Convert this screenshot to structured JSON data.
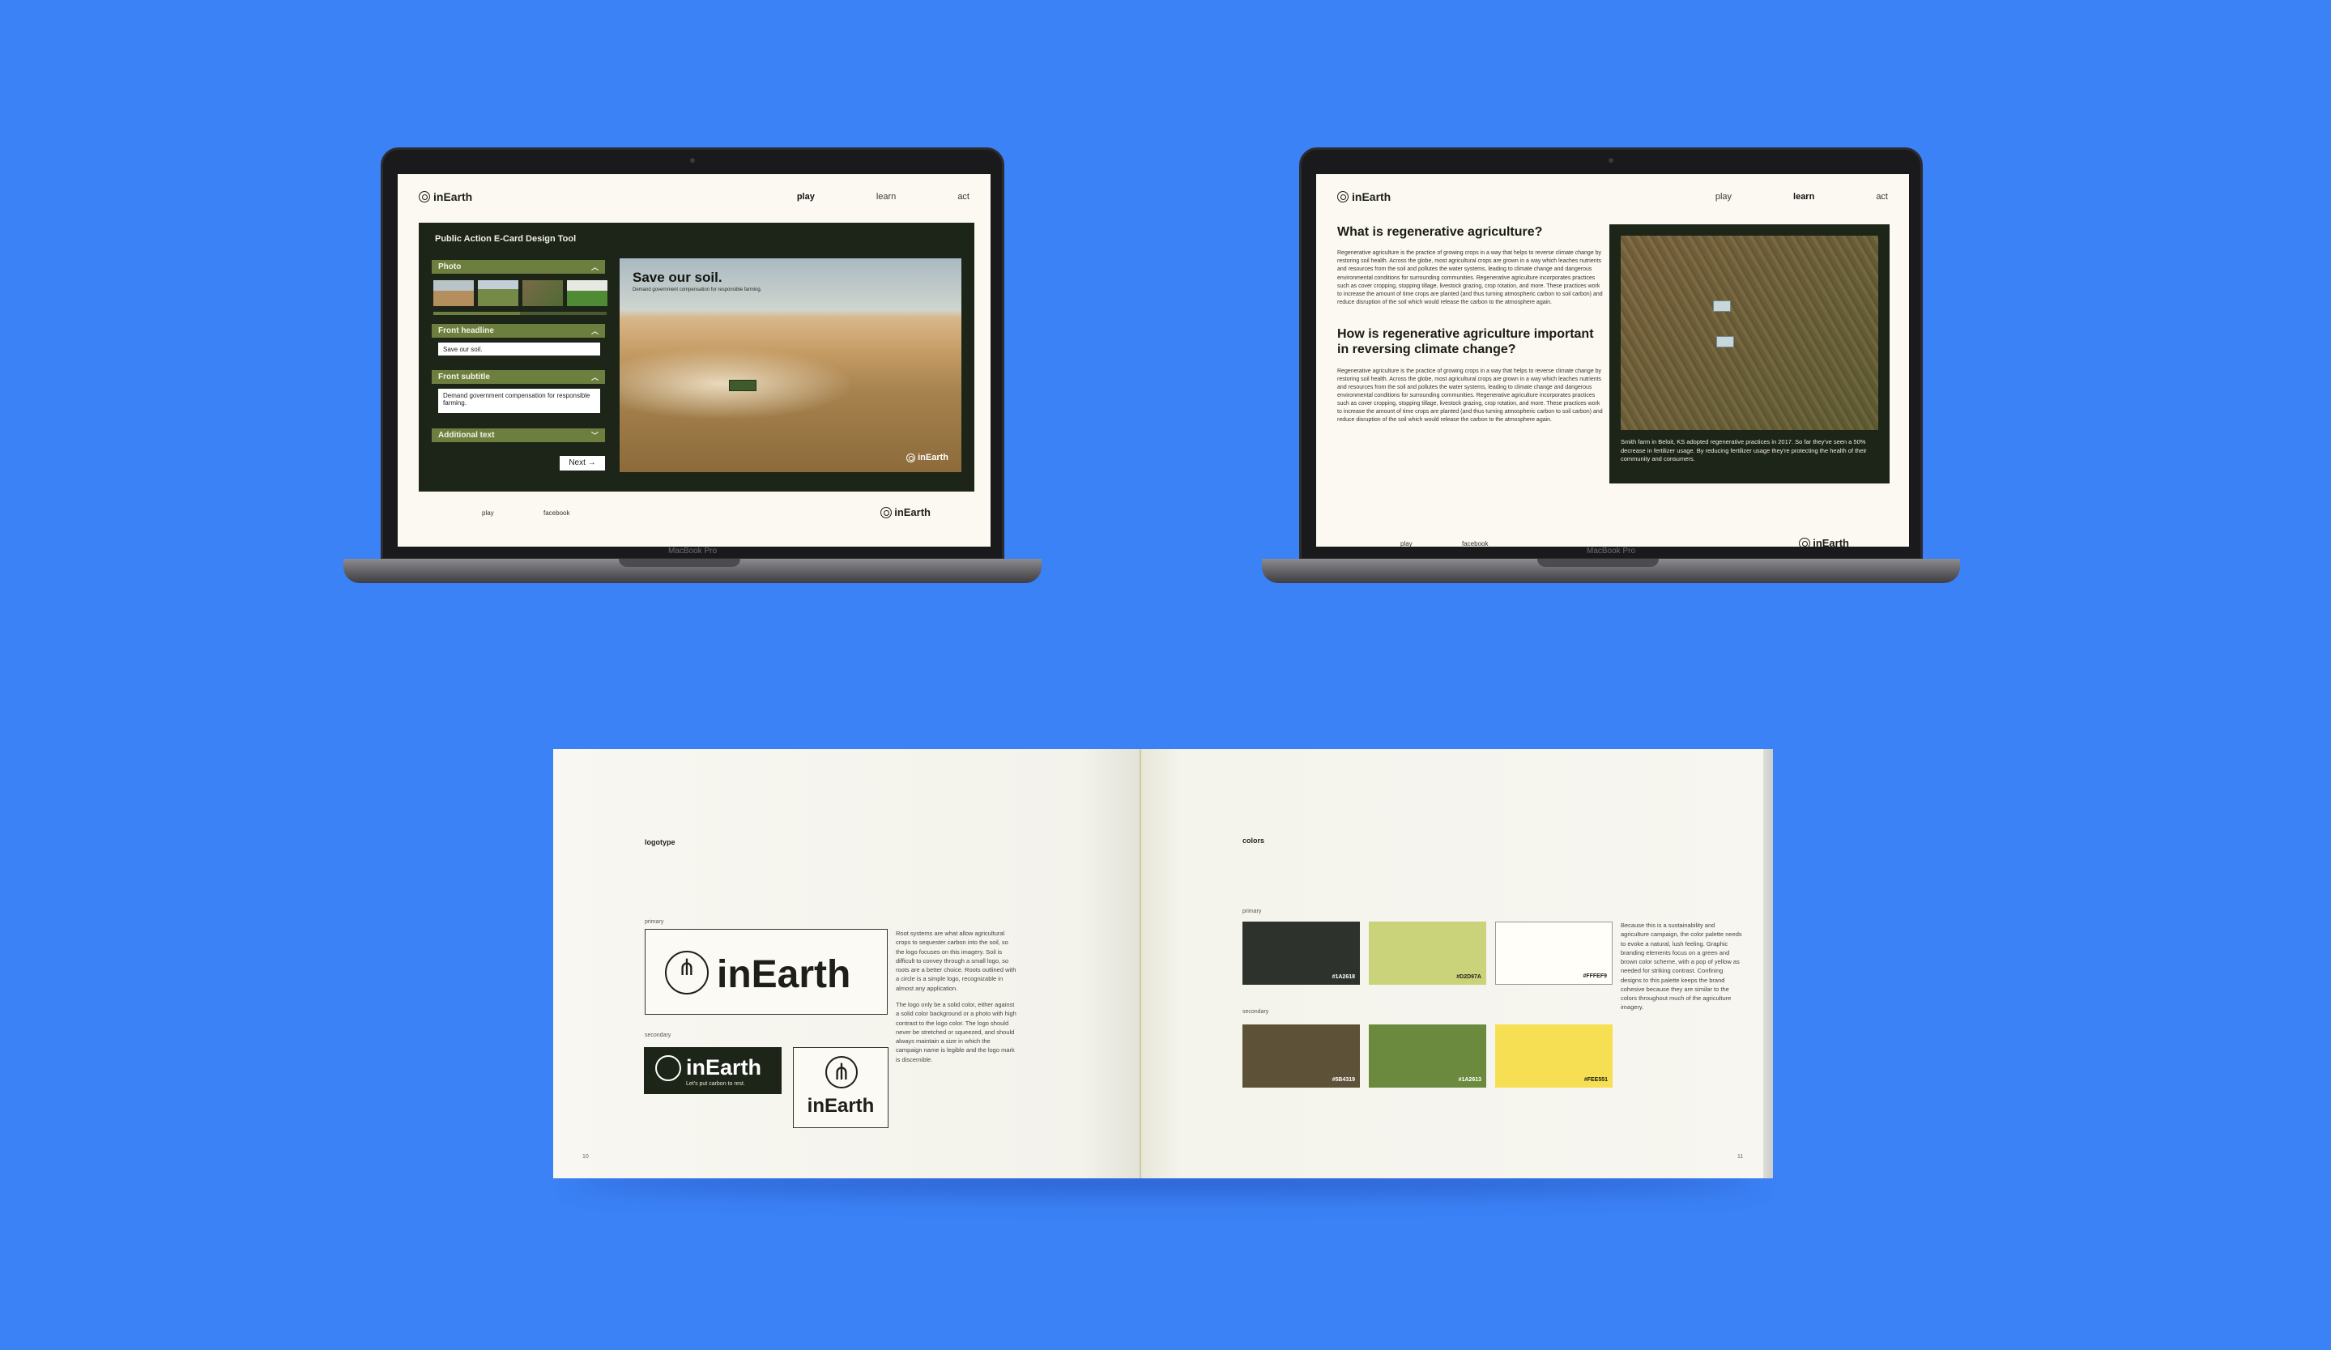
{
  "brand": {
    "name": "inEarth",
    "device_label": "MacBook Pro"
  },
  "left_laptop": {
    "nav": {
      "logo": "inEarth",
      "play": "play",
      "learn": "learn",
      "act": "act",
      "active": "play"
    },
    "tool_title": "Public Action E-Card Design Tool",
    "photo_section": "Photo",
    "headline_section": "Front headline",
    "headline_value": "Save our soil.",
    "subtitle_section": "Front subtitle",
    "subtitle_value": "Demand government compensation for responsible farming.",
    "additional_section": "Additional text",
    "next_button": "Next →",
    "preview": {
      "headline": "Save our soil.",
      "subtitle": "Demand government compensation for responsible farming.",
      "watermark": "inEarth"
    },
    "slider_fraction": 0.5,
    "footer": {
      "link1": "play",
      "link2": "facebook",
      "logo": "inEarth"
    }
  },
  "right_laptop": {
    "nav": {
      "logo": "inEarth",
      "play": "play",
      "learn": "learn",
      "act": "act",
      "active": "learn"
    },
    "q1": "What is regenerative agriculture?",
    "p1": "Regenerative agriculture is the practice of growing crops in a way that helps to reverse climate change by restoring soil health. Across the globe, most agricultural crops are grown in a way which leaches nutrients and resources from the soil and pollutes the water systems, leading to climate change and dangerous environmental conditions for surrounding communities. Regenerative agriculture incorporates practices such as cover cropping, stopping tillage, livestock grazing, crop rotation, and more. These practices work to increase the amount of time crops are planted (and thus turning atmospheric carbon to soil carbon) and reduce disruption of the soil which would release the carbon to the atmosphere again.",
    "q2": "How is regenerative agriculture important in reversing climate change?",
    "p2": "Regenerative agriculture is the practice of growing crops in a way that helps to reverse climate change by restoring soil health. Across the globe, most agricultural crops are grown in a way which leaches nutrients and resources from the soil and pollutes the water systems, leading to climate change and dangerous environmental conditions for surrounding communities. Regenerative agriculture incorporates practices such as cover cropping, stopping tillage, livestock grazing, crop rotation, and more. These practices work to increase the amount of time crops are planted (and thus turning atmospheric carbon to soil carbon) and reduce disruption of the soil which would release the carbon to the atmosphere again.",
    "caption": "Smith farm in Beloit, KS adopted regenerative practices in 2017. So far they've seen a 50% decrease in fertilizer usage. By reducing fertilizer usage they're protecting the health of their community and consumers.",
    "footer": {
      "link1": "play",
      "link2": "facebook",
      "logo": "inEarth"
    }
  },
  "book": {
    "left": {
      "section": "logotype",
      "primary_label": "primary",
      "secondary_label": "secondary",
      "wordmark": "inEarth",
      "tagline": "Let's put carbon to rest.",
      "copy1": "Root systems are what allow agricultural crops to sequester carbon into the soil, so the logo focuses on this imagery. Soil is difficult to convey through a small logo, so roots are a better choice. Roots outlined with a circle is a simple logo, recognizable in almost any application.",
      "copy2": "The logo only be a solid color, either against a solid color background or a photo with high contrast to the logo color. The logo should never be stretched or squeezed, and should always maintain a size in which the campaign name is legible and the logo mark is discernible.",
      "page_number": "10"
    },
    "right": {
      "section": "colors",
      "primary_label": "primary",
      "secondary_label": "secondary",
      "swatches_primary": [
        {
          "hex": "#1A2618",
          "color": "#2d332c",
          "text_color": "#ffffff"
        },
        {
          "hex": "#D2D97A",
          "color": "#cbd37a",
          "text_color": "#1d1f18"
        },
        {
          "hex": "#FFFEF9",
          "color": "#fffef9",
          "text_color": "#1d1f18"
        }
      ],
      "swatches_secondary": [
        {
          "hex": "#5B4319",
          "color": "#5d5138",
          "text_color": "#ffffff"
        },
        {
          "hex": "#1A2613",
          "color": "#6b8a3e",
          "text_color": "#ffffff"
        },
        {
          "hex": "#FEE551",
          "color": "#f6df52",
          "text_color": "#1d1f18"
        }
      ],
      "copy": "Because this is a sustainability and agriculture campaign, the color palette needs to evoke a natural, lush feeling. Graphic branding elements focus on a green and brown color scheme, with a pop of yellow as needed for striking contrast. Confining designs to this palette keeps the brand cohesive because they are similar to the colors throughout much of the agriculture imagery.",
      "page_number": "11"
    }
  }
}
